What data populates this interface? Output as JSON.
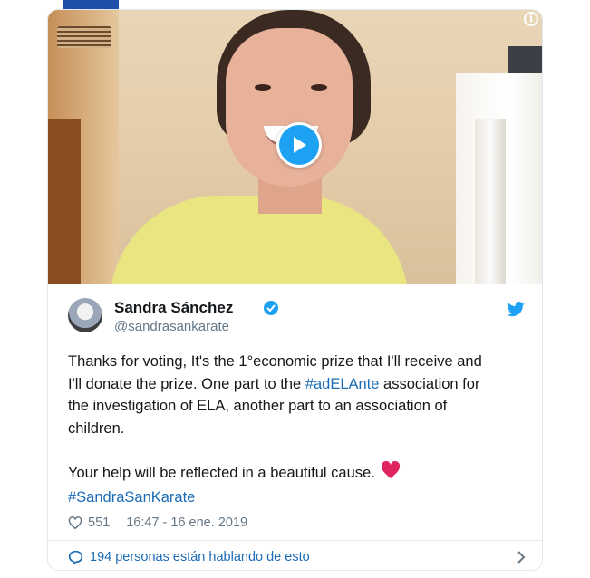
{
  "media": {
    "play_icon": "play-icon",
    "info_icon": "info-icon",
    "info_glyph": "i"
  },
  "tweet": {
    "author_name": "Sandra Sánchez",
    "author_handle": "@sandrasankarate",
    "verified": true,
    "text_line1": "Thanks for voting, It's the 1°economic prize that I'll receive and",
    "text_line2_before": "I'll donate the prize. One part to the ",
    "hashtag_adelante": "#adELAnte",
    "text_line2_after": " association  for",
    "text_line3": "the investigation of ELA, another part to an association of",
    "text_line4": "children.",
    "text_line5": "Your help will be reflected in a beautiful cause.",
    "emoji": "red-heart-emoji",
    "hashtag_sandra": "#SandraSanKarate",
    "likes": "551",
    "timestamp": "16:47 - 16 ene. 2019"
  },
  "footer": {
    "conversation_label": "194 personas están hablando de esto"
  },
  "colors": {
    "twitter_blue": "#1da1f2",
    "link_blue": "#1b6bb5",
    "heart_red": "#e0245e",
    "meta_gray": "#657786"
  }
}
